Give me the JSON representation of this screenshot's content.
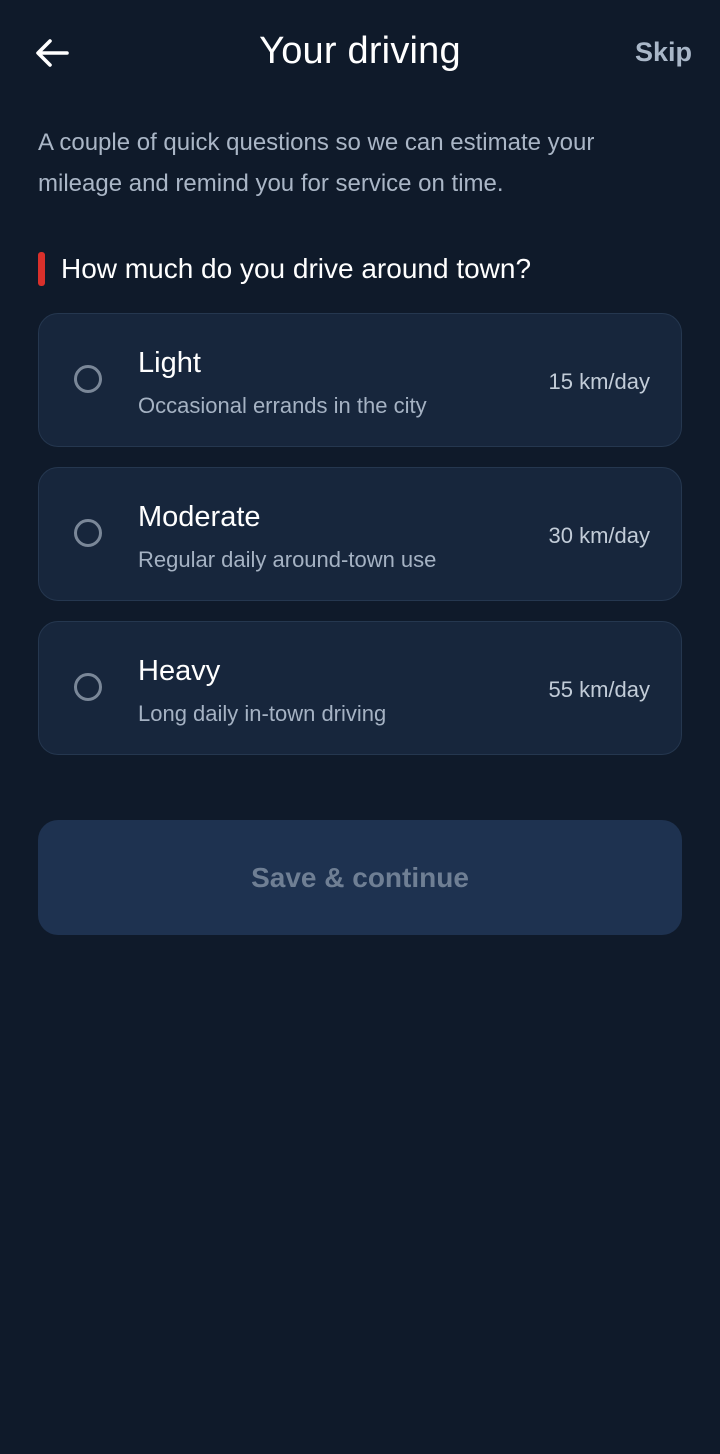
{
  "header": {
    "title": "Your driving",
    "skip_label": "Skip",
    "back_icon": "arrow-left-icon"
  },
  "intro": "A couple of quick questions so we can estimate your mileage and remind you for service on time.",
  "question": "How much do you drive around town?",
  "options": [
    {
      "title": "Light",
      "description": "Occasional errands in the city",
      "rate": "15 km/day"
    },
    {
      "title": "Moderate",
      "description": "Regular daily around-town use",
      "rate": "30 km/day"
    },
    {
      "title": "Heavy",
      "description": "Long daily in-town driving",
      "rate": "55 km/day"
    }
  ],
  "save_label": "Save & continue",
  "colors": {
    "background": "#0f1a2a",
    "card": "#17263c",
    "accent_bar": "#d9302b",
    "button_disabled": "#1e3250"
  }
}
